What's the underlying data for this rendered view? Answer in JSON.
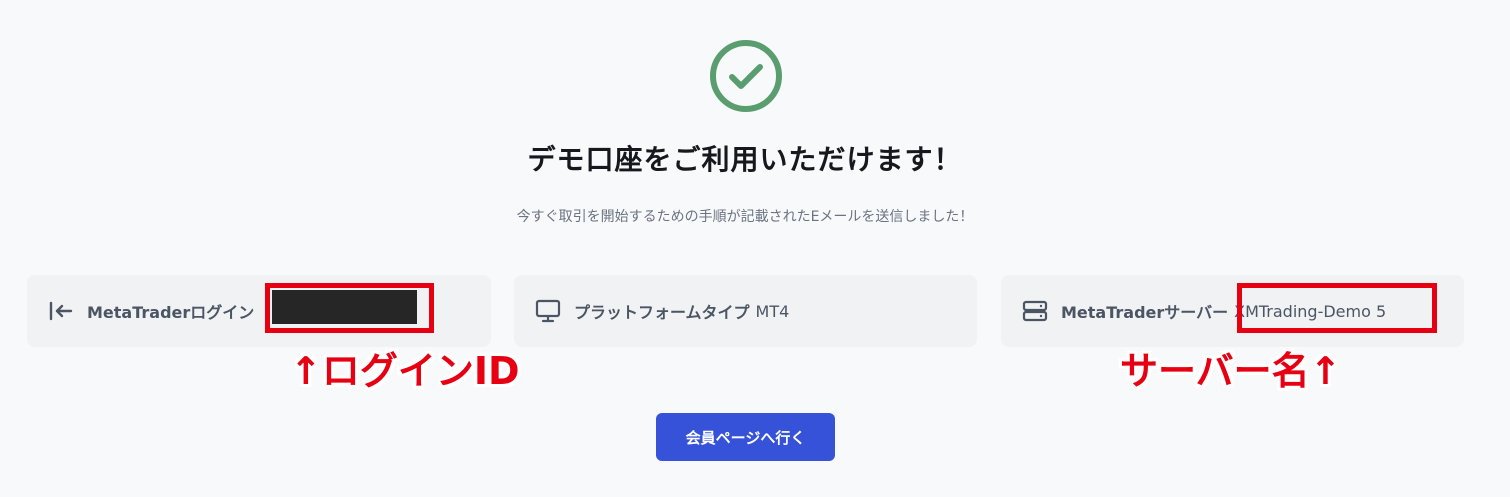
{
  "header": {
    "icon": "check-circle-icon",
    "title": "デモ口座をご利用いただけます！",
    "subtitle": "今すぐ取引を開始するための手順が記載されたEメールを送信しました！"
  },
  "cards": {
    "login": {
      "icon": "login-arrow-icon",
      "label": "MetaTraderログイン",
      "value": ""
    },
    "platform": {
      "icon": "monitor-icon",
      "label": "プラットフォームタイプ",
      "value": "MT4"
    },
    "server": {
      "icon": "server-icon",
      "label": "MetaTraderサーバー",
      "value": "XMTrading-Demo 5"
    }
  },
  "annotations": {
    "login": "↑ログインID",
    "server": "サーバー名↑"
  },
  "button": {
    "label": "会員ページへ行く"
  },
  "colors": {
    "success": "#5a9e6f",
    "annotation": "#e60012",
    "button": "#3652d9",
    "background": "#f8f9fb",
    "card": "#f1f2f4"
  }
}
